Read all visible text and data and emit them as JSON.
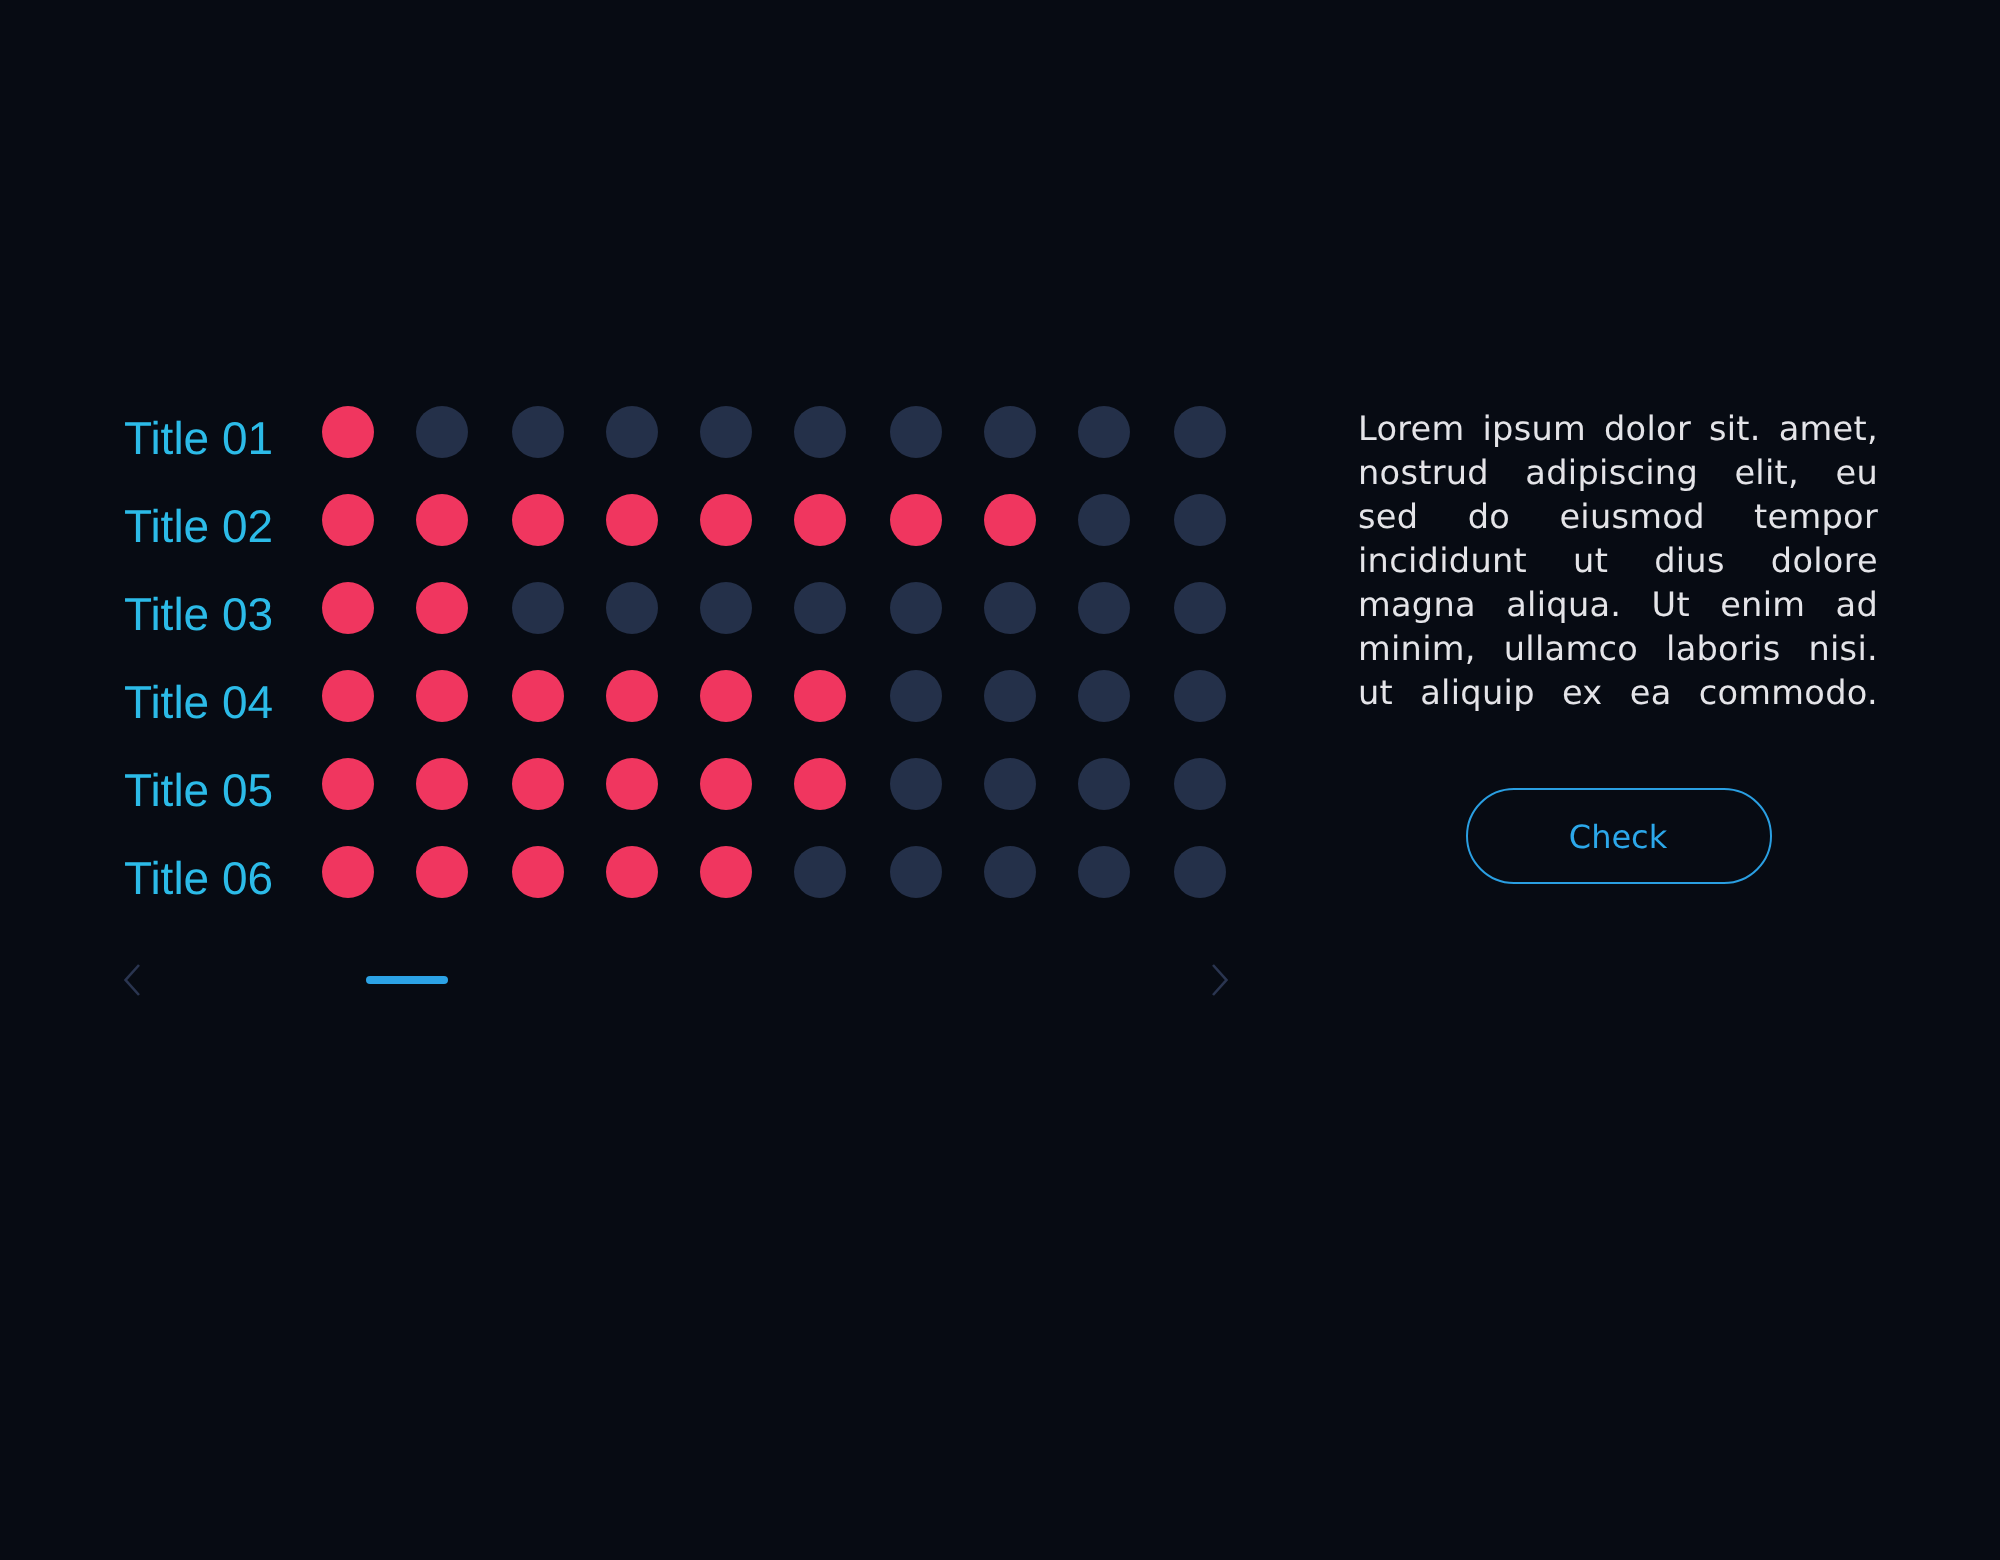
{
  "rows": [
    {
      "title": "Title 01",
      "stars": 1
    },
    {
      "title": "Title 02",
      "stars": 8
    },
    {
      "title": "Title 03",
      "stars": 2
    },
    {
      "title": "Title 04",
      "stars": 6
    },
    {
      "title": "Title 05",
      "stars": 6
    },
    {
      "title": "Title 06",
      "stars": 5
    }
  ],
  "description": {
    "lines": [
      "Lorem ipsum dolor sit. amet,",
      "nostrud adipiscing elit, eu",
      "sed do eiusmod tempor",
      "incididunt ut dius dolore",
      "magna aliqua. Ut enim ad",
      "minim, ullamco laboris nisi.",
      "ut aliquip ex ea commodo."
    ]
  },
  "button": {
    "label": "Check"
  }
}
